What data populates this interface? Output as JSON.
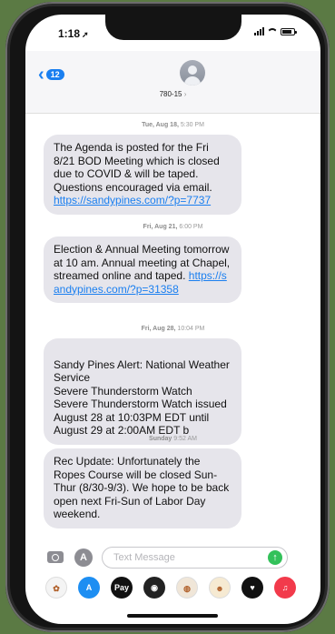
{
  "status_bar": {
    "time": "1:18"
  },
  "header": {
    "back_badge": "12",
    "contact_name": "780-15",
    "contact_chevron": "›"
  },
  "messages": [
    {
      "timestamp_day": "Tue, Aug 18,",
      "timestamp_time": "5:30 PM",
      "text": "The Agenda is posted for the Fri 8/21 BOD Meeting which is closed due to COVID & will be taped. Questions encouraged via email. ",
      "link": "https://sandypines.com/?p=7737"
    },
    {
      "timestamp_day": "Fri, Aug 21,",
      "timestamp_time": "6:00 PM",
      "text": "Election & Annual Meeting tomorrow at 10 am. Annual meeting at Chapel, streamed online and taped. ",
      "link": "https://sandypines.com/?p=31358"
    },
    {
      "timestamp_day": "Fri, Aug 28,",
      "timestamp_time": "10:04 PM",
      "text": "Sandy Pines Alert: National Weather Service\n Severe Thunderstorm Watch\nSevere Thunderstorm Watch issued August 28 at 10:03PM EDT until August 29 at 2:00AM EDT b",
      "link": ""
    },
    {
      "timestamp_day": "Sunday",
      "timestamp_time": "9:52 AM",
      "text": "Rec Update: Unfortunately the Ropes Course will be closed Sun-Thur (8/30-9/3). We hope to be back open next Fri-Sun of Labor Day weekend.",
      "link": ""
    }
  ],
  "input": {
    "placeholder": "Text Message",
    "send_icon": "↑"
  },
  "app_strip": [
    {
      "name": "photos-icon",
      "label": "✿",
      "color": "#f4f4f4"
    },
    {
      "name": "app-store-icon",
      "label": "A",
      "color": "#1d8ef2"
    },
    {
      "name": "apple-pay-icon",
      "label": "Pay",
      "color": "#111111"
    },
    {
      "name": "camera-effects-icon",
      "label": "◉",
      "color": "#222222"
    },
    {
      "name": "memoji-icon",
      "label": "◍",
      "color": "#f0e6d8"
    },
    {
      "name": "animoji-icon",
      "label": "☻",
      "color": "#f6ead2"
    },
    {
      "name": "digital-touch-icon",
      "label": "♥",
      "color": "#111111"
    },
    {
      "name": "music-icon",
      "label": "♫",
      "color": "#f23a4b"
    }
  ]
}
